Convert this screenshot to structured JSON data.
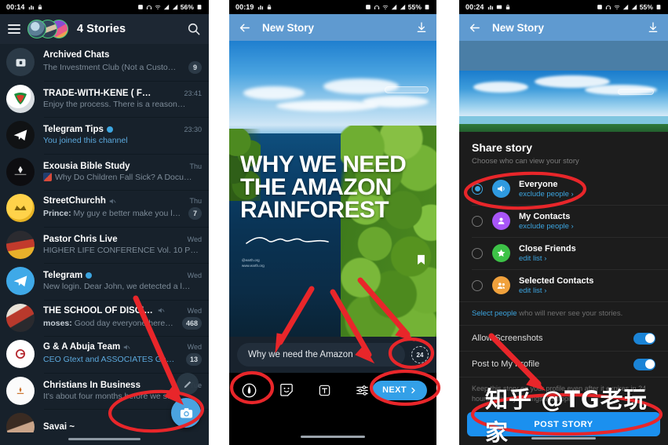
{
  "panels": {
    "chat_list": {
      "status_bar": {
        "clock": "00:14",
        "battery": "56%",
        "icons": [
          "chart-icon",
          "lock-icon",
          "alarm-icon",
          "headphones-icon",
          "wifi-icon",
          "signal-icon",
          "signal2-icon"
        ]
      },
      "header": {
        "menu_icon": "hamburger-icon",
        "stories_label": "4 Stories",
        "search_icon": "search-icon"
      },
      "rows": [
        {
          "name": "Archived Chats",
          "message": "The Investment Club (Not a Custo…",
          "time": "",
          "badge": "9",
          "sender": "",
          "avatar": "archive-icon",
          "muted": false,
          "verified": false,
          "msg_blue": false
        },
        {
          "name": "TRADE-WITH-KENE ( FREE G…",
          "message": "Enjoy the process.  There is a reason…",
          "time": "23:41",
          "badge": "",
          "sender": "",
          "avatar": "trade-avatar",
          "muted": false,
          "verified": false,
          "msg_blue": false
        },
        {
          "name": "Telegram Tips",
          "message": "You joined this channel",
          "time": "23:30",
          "badge": "",
          "sender": "",
          "avatar": "telegram-dark-avatar",
          "muted": false,
          "verified": true,
          "msg_blue": true
        },
        {
          "name": "Exousia Bible Study",
          "message": "Why Do Children Fall Sick?  A Docu…",
          "time": "Thu",
          "badge": "",
          "sender": "",
          "avatar": "exousia-avatar",
          "muted": false,
          "verified": false,
          "msg_blue": false,
          "thumb": true
        },
        {
          "name": "StreetChurchh",
          "message": "My guy e better make you l…",
          "time": "Thu",
          "badge": "7",
          "sender": "Prince:",
          "avatar": "streetchurch-avatar",
          "muted": true,
          "verified": false,
          "msg_blue": false
        },
        {
          "name": "Pastor Chris Live",
          "message": "HIGHER LIFE CONFERENCE Vol. 10 Pa…",
          "time": "Wed",
          "badge": "",
          "sender": "",
          "avatar": "pastorchris-avatar",
          "muted": false,
          "verified": false,
          "msg_blue": false
        },
        {
          "name": "Telegram",
          "message": "New login. Dear John, we detected a l…",
          "time": "Wed",
          "badge": "",
          "sender": "",
          "avatar": "telegram-blue-avatar",
          "muted": false,
          "verified": true,
          "msg_blue": false
        },
        {
          "name": "THE SCHOOL OF DISCIPLES…",
          "message": "Good day everyone here…",
          "time": "Wed",
          "badge": "468",
          "sender": "moses:",
          "avatar": "school-avatar",
          "muted": true,
          "verified": false,
          "msg_blue": false
        },
        {
          "name": "G & A Abuja Team",
          "message": "CEO Gtext and ASSOCIATES Ga…",
          "time": "Wed",
          "badge": "13",
          "sender": "",
          "avatar": "gtext-avatar",
          "muted": true,
          "verified": false,
          "msg_blue": true
        },
        {
          "name": "Christians In Business",
          "message": "It's about four months before we s…",
          "time": "Tue",
          "badge": "",
          "sender": "",
          "avatar": "cib-avatar",
          "muted": false,
          "verified": false,
          "msg_blue": false
        },
        {
          "name": "Savai ~",
          "message": "",
          "time": "",
          "badge": "",
          "sender": "",
          "avatar": "savai-avatar",
          "muted": false,
          "verified": false,
          "msg_blue": false
        }
      ],
      "fab_edit_icon": "pencil-icon",
      "fab_camera_icon": "camera-icon"
    },
    "story_editor": {
      "status_bar": {
        "clock": "00:19",
        "battery": "55%"
      },
      "header": {
        "back_icon": "back-arrow-icon",
        "title": "New Story",
        "download_icon": "download-icon"
      },
      "poster": {
        "line1": "WHY WE  NEED",
        "line2": "THE AMAZON",
        "line3": "RAINFOREST",
        "credit_line1": "@earth.org",
        "credit_line2": "www.earth.org",
        "bookmark_icon": "bookmark-icon"
      },
      "caption": {
        "text": "Why we need the Amazon",
        "timer_label": "24",
        "timer_name": "story-duration-24h"
      },
      "tools": [
        {
          "name": "draw-tool-icon"
        },
        {
          "name": "sticker-tool-icon"
        },
        {
          "name": "text-tool-icon"
        },
        {
          "name": "adjust-tool-icon"
        }
      ],
      "next_label": "NEXT",
      "next_chevron": "chevron-right-icon"
    },
    "share_sheet": {
      "status_bar": {
        "clock": "00:24",
        "battery": "55%"
      },
      "header": {
        "back_icon": "back-arrow-icon",
        "title": "New Story",
        "download_icon": "download-icon"
      },
      "title": "Share story",
      "subtitle": "Choose who can view your story",
      "options": [
        {
          "name": "Everyone",
          "sub": "exclude people ›",
          "selected": true,
          "icon": "megaphone-icon",
          "color": "#2f9ae0"
        },
        {
          "name": "My Contacts",
          "sub": "exclude people ›",
          "selected": false,
          "icon": "person-icon",
          "color": "#a855f7"
        },
        {
          "name": "Close Friends",
          "sub": "edit list ›",
          "selected": false,
          "icon": "star-icon",
          "color": "#3dc247"
        },
        {
          "name": "Selected Contacts",
          "sub": "edit list ›",
          "selected": false,
          "icon": "people-icon",
          "color": "#f0a13c"
        }
      ],
      "note_link": "Select people",
      "note_rest": " who will never see your stories.",
      "toggles": [
        {
          "label": "Allow Screenshots",
          "on": true
        },
        {
          "label": "Post to My Profile",
          "on": true
        }
      ],
      "footer_note": "Keep this story on your profile even after it expires in 24 hours. Privacy settings will apply.",
      "post_label": "POST STORY"
    }
  },
  "watermark": {
    "text": "知乎 @TG老玩家"
  },
  "annotations": {
    "accent_color": "#e8262a",
    "ellipses": [
      "chat-list-camera-fab",
      "story-timer-24",
      "story-draw-tool",
      "story-next-button",
      "share-everyone-option",
      "share-post-story-button"
    ],
    "arrows": [
      "arrow-to-camera-fab",
      "arrow-to-caption",
      "arrow-to-timer",
      "arrow-to-next",
      "arrow-to-footer-note"
    ]
  }
}
